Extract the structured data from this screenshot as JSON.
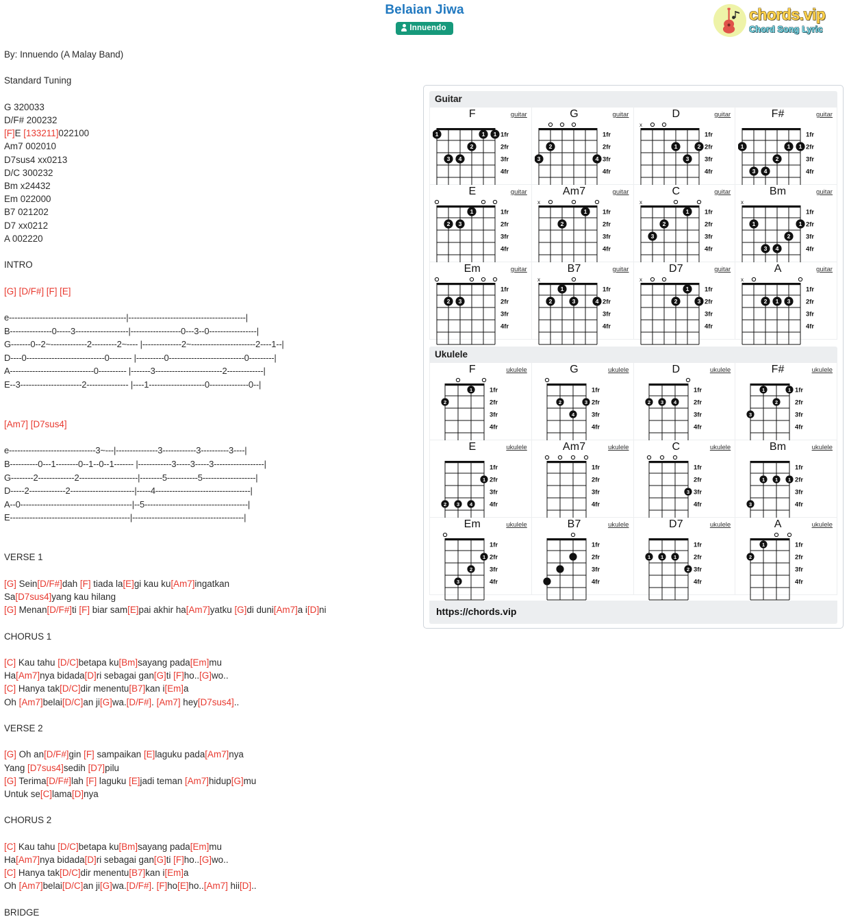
{
  "header": {
    "title": "Belaian Jiwa",
    "artist_badge": "Innuendo",
    "artist_icon": "person-icon"
  },
  "logo": {
    "main": "chords.vip",
    "sub": "Chord Song Lyric",
    "icon": "guitar-icon"
  },
  "song": {
    "credit": "By: Innuendo (A Malay Band)",
    "tuning": "Standard Tuning",
    "chord_list": [
      "G 320033",
      "D/F# 200232",
      "[F]E [133211]022100",
      "Am7 002010",
      "D7sus4 xx0213",
      "D/C 300232",
      "Bm x24432",
      "Em 022000",
      "B7 021202",
      "D7 xx0212",
      "A 002220"
    ],
    "section_intro_label": "INTRO",
    "intro_chords": "[G] [D/F#] [F] [E]",
    "tab1": [
      "e------------------------------------------|------------------------------------------|",
      "B---------------0-----3-------------------|------------------0---3--0-----------------|",
      "G-------0--2~-------------2---------2~---- |--------------2~-----------------------2----1--|",
      "D----0----------------------------0-------- |----------0---------------------------0---------|",
      "A------------------------------0---------- |-------3------------------------2-------------|",
      "E--3----------------------2--------------- |----1--------------------0--------------0--|"
    ],
    "tab2_chords": "[Am7] [D7sus4]",
    "tab2": [
      "e-------------------------------3~---|---------------3------------3----------3----|",
      "B----------0---1--------0--1--0--1------- |------------3-----3-----3------------------|",
      "G--------2-------------2---------------------|--------5-----------5-------------------|",
      "D-----2-------------2-----------------------|-----4----------------------------------|",
      "A--0----------------------------------------|--5-------------------------------------|",
      "E-------------------------------------------|----------------------------------------|"
    ],
    "verse1_label": "VERSE 1",
    "verse1": [
      "[G] Sein[D/F#]dah [F] tiada la[E]gi kau ku[Am7]ingatkan",
      "Sa[D7sus4]yang kau hilang",
      "[G] Menan[D/F#]ti [F] biar sam[E]pai akhir ha[Am7]yatku [G]di duni[Am7]a i[D]ni"
    ],
    "chorus1_label": "CHORUS 1",
    "chorus1": [
      "[C] Kau tahu [D/C]betapa ku[Bm]sayang pada[Em]mu",
      "Ha[Am7]nya bidada[D]ri sebagai gan[G]ti [F]ho..[G]wo..",
      "[C] Hanya tak[D/C]dir menentu[B7]kan i[Em]a",
      "Oh [Am7]belai[D/C]an ji[G]wa.[D/F#]. [Am7] hey[D7sus4].."
    ],
    "verse2_label": "VERSE 2",
    "verse2": [
      "[G] Oh an[D/F#]gin [F] sampaikan [E]laguku pada[Am7]nya",
      "Yang [D7sus4]sedih [D7]pilu",
      "[G] Terima[D/F#]lah [F] laguku [E]jadi teman [Am7]hidup[G]mu",
      "Untuk se[C]lama[D]nya"
    ],
    "chorus2_label": "CHORUS 2",
    "chorus2": [
      "[C] Kau tahu [D/C]betapa ku[Bm]sayang pada[Em]mu",
      "Ha[Am7]nya bidada[D]ri sebagai gan[G]ti [F]ho..[G]wo..",
      "[C] Hanya tak[D/C]dir menentu[B7]kan i[Em]a",
      "Oh [Am7]belai[D/C]an ji[G]wa.[D/F#]. [F]ho[E]ho..[Am7] hii[D].."
    ],
    "bridge_label": "BRIDGE"
  },
  "chords_panel": {
    "guitar_header": "Guitar",
    "ukulele_header": "Ukulele",
    "footer_url": "https://chords.vip",
    "fret_labels": [
      "1fr",
      "2fr",
      "3fr",
      "4fr"
    ],
    "guitar_kind_label": "guitar",
    "ukulele_kind_label": "ukulele",
    "guitar": [
      {
        "name": "F",
        "strings": 6,
        "open": [
          "",
          "",
          "",
          "",
          "",
          ""
        ],
        "dots": [
          {
            "s": 6,
            "f": 1,
            "n": "1"
          },
          {
            "s": 2,
            "f": 1,
            "n": "1"
          },
          {
            "s": 1,
            "f": 1,
            "n": "1"
          },
          {
            "s": 3,
            "f": 2,
            "n": "2"
          },
          {
            "s": 5,
            "f": 3,
            "n": "3"
          },
          {
            "s": 4,
            "f": 3,
            "n": "4"
          }
        ]
      },
      {
        "name": "G",
        "strings": 6,
        "open": [
          "",
          "o",
          "o",
          "o",
          "",
          ""
        ],
        "dots": [
          {
            "s": 5,
            "f": 2,
            "n": "2"
          },
          {
            "s": 6,
            "f": 3,
            "n": "3"
          },
          {
            "s": 1,
            "f": 3,
            "n": "4"
          }
        ]
      },
      {
        "name": "D",
        "strings": 6,
        "open": [
          "x",
          "o",
          "o",
          "",
          "",
          ""
        ],
        "dots": [
          {
            "s": 3,
            "f": 2,
            "n": "1"
          },
          {
            "s": 1,
            "f": 2,
            "n": "2"
          },
          {
            "s": 2,
            "f": 3,
            "n": "3"
          }
        ]
      },
      {
        "name": "F#",
        "strings": 6,
        "open": [
          "",
          "",
          "",
          "",
          "",
          ""
        ],
        "dots": [
          {
            "s": 6,
            "f": 2,
            "n": "1"
          },
          {
            "s": 2,
            "f": 2,
            "n": "1"
          },
          {
            "s": 1,
            "f": 2,
            "n": "1"
          },
          {
            "s": 3,
            "f": 3,
            "n": "2"
          },
          {
            "s": 5,
            "f": 4,
            "n": "3"
          },
          {
            "s": 4,
            "f": 4,
            "n": "4"
          }
        ]
      },
      {
        "name": "E",
        "strings": 6,
        "open": [
          "o",
          "",
          "",
          "",
          "o",
          "o"
        ],
        "dots": [
          {
            "s": 3,
            "f": 1,
            "n": "1"
          },
          {
            "s": 5,
            "f": 2,
            "n": "2"
          },
          {
            "s": 4,
            "f": 2,
            "n": "3"
          }
        ]
      },
      {
        "name": "Am7",
        "strings": 6,
        "open": [
          "x",
          "o",
          "",
          "o",
          "",
          "o"
        ],
        "dots": [
          {
            "s": 2,
            "f": 1,
            "n": "1"
          },
          {
            "s": 4,
            "f": 2,
            "n": "2"
          }
        ]
      },
      {
        "name": "C",
        "strings": 6,
        "open": [
          "x",
          "",
          "",
          "o",
          "",
          "o"
        ],
        "dots": [
          {
            "s": 2,
            "f": 1,
            "n": "1"
          },
          {
            "s": 4,
            "f": 2,
            "n": "2"
          },
          {
            "s": 5,
            "f": 3,
            "n": "3"
          }
        ]
      },
      {
        "name": "Bm",
        "strings": 6,
        "open": [
          "x",
          "",
          "",
          "",
          "",
          ""
        ],
        "dots": [
          {
            "s": 5,
            "f": 2,
            "n": "1"
          },
          {
            "s": 1,
            "f": 2,
            "n": "1"
          },
          {
            "s": 2,
            "f": 3,
            "n": "2"
          },
          {
            "s": 4,
            "f": 4,
            "n": "3"
          },
          {
            "s": 3,
            "f": 4,
            "n": "4"
          }
        ]
      },
      {
        "name": "Em",
        "strings": 6,
        "open": [
          "o",
          "",
          "",
          "o",
          "o",
          "o"
        ],
        "dots": [
          {
            "s": 5,
            "f": 2,
            "n": "2"
          },
          {
            "s": 4,
            "f": 2,
            "n": "3"
          }
        ]
      },
      {
        "name": "B7",
        "strings": 6,
        "open": [
          "x",
          "",
          "",
          "o",
          "",
          ""
        ],
        "dots": [
          {
            "s": 4,
            "f": 1,
            "n": "1"
          },
          {
            "s": 5,
            "f": 2,
            "n": "2"
          },
          {
            "s": 3,
            "f": 2,
            "n": "3"
          },
          {
            "s": 1,
            "f": 2,
            "n": "4"
          }
        ]
      },
      {
        "name": "D7",
        "strings": 6,
        "open": [
          "x",
          "o",
          "o",
          "",
          "",
          ""
        ],
        "dots": [
          {
            "s": 2,
            "f": 1,
            "n": "1"
          },
          {
            "s": 3,
            "f": 2,
            "n": "2"
          },
          {
            "s": 1,
            "f": 2,
            "n": "3"
          }
        ]
      },
      {
        "name": "A",
        "strings": 6,
        "open": [
          "x",
          "o",
          "",
          "",
          "",
          "o"
        ],
        "dots": [
          {
            "s": 4,
            "f": 2,
            "n": "2"
          },
          {
            "s": 3,
            "f": 2,
            "n": "1"
          },
          {
            "s": 2,
            "f": 2,
            "n": "3"
          }
        ]
      }
    ],
    "ukulele": [
      {
        "name": "F",
        "strings": 4,
        "open": [
          "",
          "o",
          "",
          "o"
        ],
        "dots": [
          {
            "s": 2,
            "f": 1,
            "n": "1"
          },
          {
            "s": 4,
            "f": 2,
            "n": "2"
          }
        ]
      },
      {
        "name": "G",
        "strings": 4,
        "open": [
          "o",
          "",
          "",
          ""
        ],
        "dots": [
          {
            "s": 3,
            "f": 2,
            "n": "2"
          },
          {
            "s": 1,
            "f": 2,
            "n": "3"
          },
          {
            "s": 2,
            "f": 3,
            "n": "4"
          }
        ]
      },
      {
        "name": "D",
        "strings": 4,
        "open": [
          "",
          "",
          "",
          "o"
        ],
        "dots": [
          {
            "s": 4,
            "f": 2,
            "n": "2"
          },
          {
            "s": 3,
            "f": 2,
            "n": "3"
          },
          {
            "s": 2,
            "f": 2,
            "n": "4"
          }
        ]
      },
      {
        "name": "F#",
        "strings": 4,
        "open": [
          "",
          "",
          "",
          ""
        ],
        "dots": [
          {
            "s": 3,
            "f": 1,
            "n": "1"
          },
          {
            "s": 1,
            "f": 1,
            "n": "1"
          },
          {
            "s": 2,
            "f": 2,
            "n": "2"
          },
          {
            "s": 4,
            "f": 3,
            "n": "3"
          }
        ]
      },
      {
        "name": "E",
        "strings": 4,
        "open": [
          "",
          "",
          "",
          ""
        ],
        "dots": [
          {
            "s": 1,
            "f": 2,
            "n": "1"
          },
          {
            "s": 4,
            "f": 4,
            "n": "2"
          },
          {
            "s": 3,
            "f": 4,
            "n": "3"
          },
          {
            "s": 2,
            "f": 4,
            "n": "4"
          }
        ]
      },
      {
        "name": "Am7",
        "strings": 4,
        "open": [
          "o",
          "o",
          "o",
          "o"
        ],
        "dots": []
      },
      {
        "name": "C",
        "strings": 4,
        "open": [
          "o",
          "o",
          "o",
          ""
        ],
        "dots": [
          {
            "s": 1,
            "f": 3,
            "n": "3"
          }
        ]
      },
      {
        "name": "Bm",
        "strings": 4,
        "open": [
          "",
          "",
          "",
          ""
        ],
        "dots": [
          {
            "s": 3,
            "f": 2,
            "n": "1"
          },
          {
            "s": 2,
            "f": 2,
            "n": "1"
          },
          {
            "s": 1,
            "f": 2,
            "n": "1"
          },
          {
            "s": 4,
            "f": 4,
            "n": "3"
          }
        ]
      },
      {
        "name": "Em",
        "strings": 4,
        "open": [
          "o",
          "",
          "",
          ""
        ],
        "dots": [
          {
            "s": 1,
            "f": 2,
            "n": "1"
          },
          {
            "s": 2,
            "f": 3,
            "n": "2"
          },
          {
            "s": 3,
            "f": 4,
            "n": "3"
          }
        ]
      },
      {
        "name": "B7",
        "strings": 4,
        "open": [
          "",
          "",
          "o",
          ""
        ],
        "dots": [
          {
            "s": 2,
            "f": 2,
            "n": ""
          },
          {
            "s": 3,
            "f": 3,
            "n": ""
          },
          {
            "s": 4,
            "f": 4,
            "n": ""
          }
        ]
      },
      {
        "name": "D7",
        "strings": 4,
        "open": [
          "",
          "",
          "",
          ""
        ],
        "dots": [
          {
            "s": 4,
            "f": 2,
            "n": "1"
          },
          {
            "s": 3,
            "f": 2,
            "n": "1"
          },
          {
            "s": 2,
            "f": 2,
            "n": "1"
          },
          {
            "s": 1,
            "f": 3,
            "n": "2"
          }
        ]
      },
      {
        "name": "A",
        "strings": 4,
        "open": [
          "",
          "",
          "o",
          "o"
        ],
        "dots": [
          {
            "s": 3,
            "f": 1,
            "n": "1"
          },
          {
            "s": 4,
            "f": 2,
            "n": "2"
          }
        ]
      }
    ]
  }
}
